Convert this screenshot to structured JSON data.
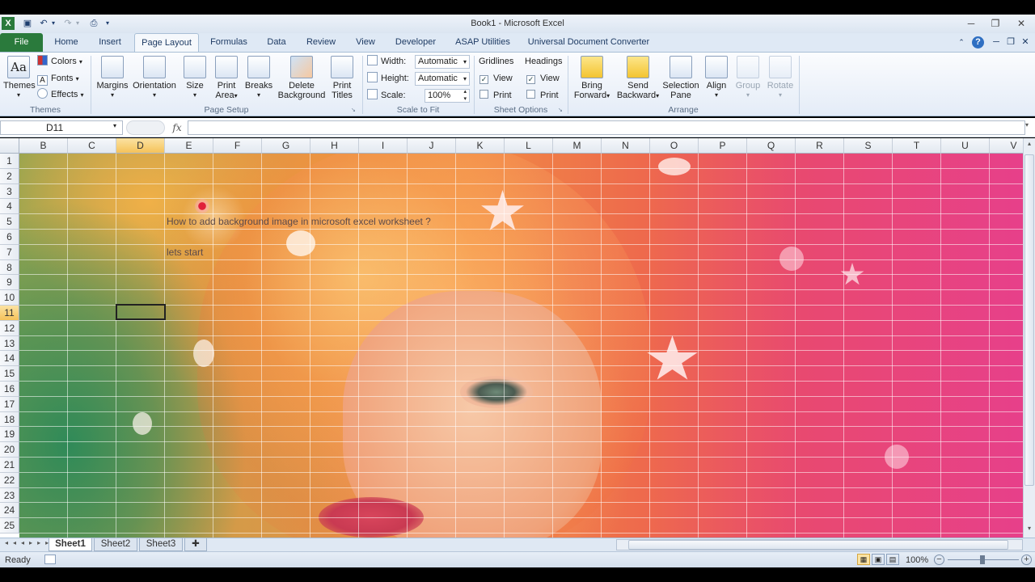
{
  "window": {
    "title": "Book1 - Microsoft Excel",
    "minimize": "─",
    "restore": "❐",
    "close": "✕"
  },
  "tabs": [
    {
      "label": "File"
    },
    {
      "label": "Home"
    },
    {
      "label": "Insert"
    },
    {
      "label": "Page Layout"
    },
    {
      "label": "Formulas"
    },
    {
      "label": "Data"
    },
    {
      "label": "Review"
    },
    {
      "label": "View"
    },
    {
      "label": "Developer"
    },
    {
      "label": "ASAP Utilities"
    },
    {
      "label": "Universal Document Converter"
    }
  ],
  "ribbon": {
    "themes": {
      "group": "Themes",
      "themes_label": "Themes",
      "colors": "Colors",
      "fonts": "Fonts",
      "effects": "Effects"
    },
    "page_setup": {
      "group": "Page Setup",
      "margins": "Margins",
      "orientation": "Orientation",
      "size": "Size",
      "print_area_1": "Print",
      "print_area_2": "Area",
      "breaks": "Breaks",
      "delete_bg_1": "Delete",
      "delete_bg_2": "Background",
      "print_titles_1": "Print",
      "print_titles_2": "Titles"
    },
    "scale_to_fit": {
      "group": "Scale to Fit",
      "width_label": "Width:",
      "width_value": "Automatic",
      "height_label": "Height:",
      "height_value": "Automatic",
      "scale_label": "Scale:",
      "scale_value": "100%"
    },
    "sheet_options": {
      "group": "Sheet Options",
      "gridlines": "Gridlines",
      "headings": "Headings",
      "view": "View",
      "print": "Print",
      "gridlines_view_checked": true,
      "gridlines_print_checked": false,
      "headings_view_checked": true,
      "headings_print_checked": false
    },
    "arrange": {
      "group": "Arrange",
      "bring_forward_1": "Bring",
      "bring_forward_2": "Forward",
      "send_backward_1": "Send",
      "send_backward_2": "Backward",
      "selection_pane_1": "Selection",
      "selection_pane_2": "Pane",
      "align": "Align",
      "group_btn": "Group",
      "rotate": "Rotate"
    }
  },
  "formula_bar": {
    "name_box": "D11",
    "fx": "fx",
    "content": ""
  },
  "columns": [
    "B",
    "C",
    "D",
    "E",
    "F",
    "G",
    "H",
    "I",
    "J",
    "K",
    "L",
    "M",
    "N",
    "O",
    "P",
    "Q",
    "R",
    "S",
    "T",
    "U",
    "V"
  ],
  "rows": [
    "1",
    "2",
    "3",
    "4",
    "5",
    "6",
    "7",
    "8",
    "9",
    "10",
    "11",
    "12",
    "13",
    "14",
    "15",
    "16",
    "17",
    "18",
    "19",
    "20",
    "21",
    "22",
    "23",
    "24",
    "25"
  ],
  "selected_cell": {
    "column": "D",
    "row": "11"
  },
  "cells": {
    "E5": "How to add background image in microsoft excel worksheet ?",
    "E7": "lets start"
  },
  "sheet_tabs": [
    {
      "label": "Sheet1"
    },
    {
      "label": "Sheet2"
    },
    {
      "label": "Sheet3"
    }
  ],
  "status": {
    "ready": "Ready",
    "zoom": "100%"
  },
  "colors": {
    "file_tab": "#2a7a3c",
    "selection_header": "#f5c25a",
    "ribbon_bg": "#e4ecf7"
  }
}
